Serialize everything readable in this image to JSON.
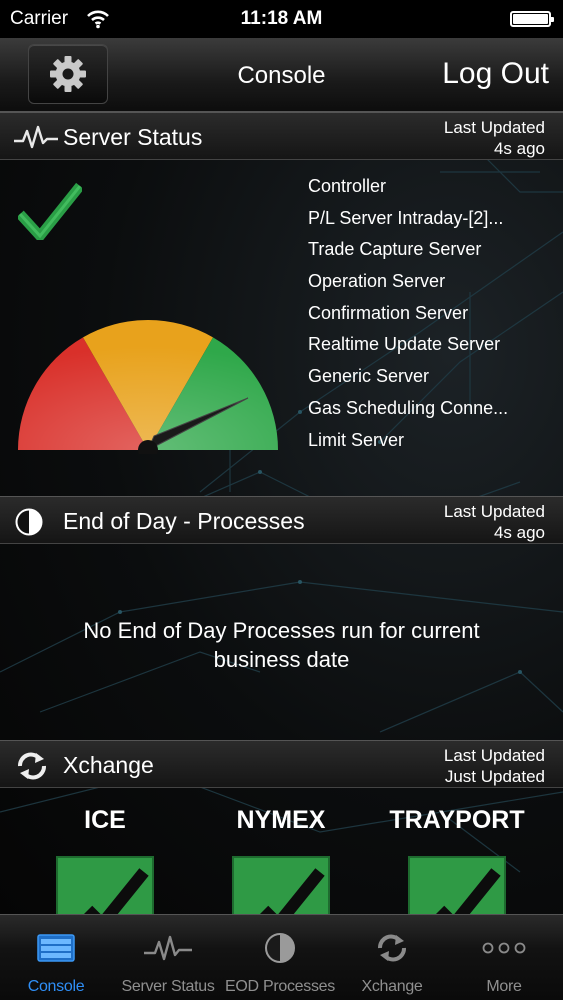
{
  "status_bar": {
    "carrier": "Carrier",
    "time": "11:18 AM"
  },
  "navbar": {
    "title": "Console",
    "logout_label": "Log Out"
  },
  "server_status": {
    "title": "Server Status",
    "last_updated_label": "Last Updated",
    "last_updated_value": "4s ago",
    "servers": [
      "Controller",
      "P/L Server Intraday-[2]...",
      "Trade Capture Server",
      "Operation Server",
      "Confirmation Server",
      "Realtime Update Server",
      "Generic Server",
      "Gas Scheduling Conne...",
      "Limit Server"
    ],
    "colors": {
      "ok": "#2fa84a",
      "warn": "#e8a21c",
      "error": "#d9302a"
    }
  },
  "end_of_day": {
    "title": "End of Day - Processes",
    "last_updated_label": "Last Updated",
    "last_updated_value": "4s ago",
    "message": "No End of Day Processes run for current business date"
  },
  "xchange": {
    "title": "Xchange",
    "last_updated_label": "Last Updated",
    "last_updated_value": "Just Updated",
    "exchanges": [
      "ICE",
      "NYMEX",
      "TRAYPORT"
    ]
  },
  "tabbar": {
    "tabs": [
      {
        "label": "Console",
        "icon": "console-icon",
        "active": true
      },
      {
        "label": "Server Status",
        "icon": "pulse-icon",
        "active": false
      },
      {
        "label": "EOD Processes",
        "icon": "half-circle-icon",
        "active": false
      },
      {
        "label": "Xchange",
        "icon": "sync-icon",
        "active": false
      },
      {
        "label": "More",
        "icon": "more-dots-icon",
        "active": false
      }
    ],
    "active_color": "#2f8ef5"
  }
}
